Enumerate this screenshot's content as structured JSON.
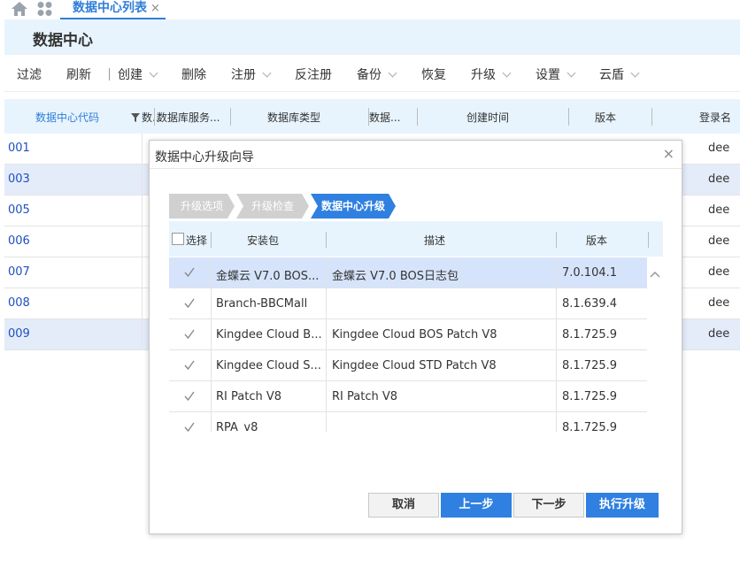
{
  "topbar": {
    "tab_title": "数据中心列表",
    "tab_close": "×"
  },
  "header": {
    "title": "数据中心"
  },
  "toolbar": [
    {
      "label": "过滤",
      "dropdown": false
    },
    {
      "label": "刷新",
      "dropdown": false
    },
    {
      "label": "创建",
      "dropdown": true
    },
    {
      "label": "删除",
      "dropdown": false
    },
    {
      "label": "注册",
      "dropdown": true
    },
    {
      "label": "反注册",
      "dropdown": false
    },
    {
      "label": "备份",
      "dropdown": true
    },
    {
      "label": "恢复",
      "dropdown": false
    },
    {
      "label": "升级",
      "dropdown": true
    },
    {
      "label": "设置",
      "dropdown": true
    },
    {
      "label": "云盾",
      "dropdown": true
    }
  ],
  "grid": {
    "headers": [
      "数据中心代码",
      "数...",
      "数据库服务...",
      "数据库类型",
      "数据...",
      "创建时间",
      "版本",
      "登录名"
    ],
    "rows": [
      {
        "code": "001",
        "login": "dee",
        "selected": false
      },
      {
        "code": "003",
        "login": "dee",
        "selected": true
      },
      {
        "code": "005",
        "login": "dee",
        "selected": false
      },
      {
        "code": "006",
        "login": "dee",
        "selected": false
      },
      {
        "code": "007",
        "login": "dee",
        "selected": false
      },
      {
        "code": "008",
        "login": "dee",
        "selected": false
      },
      {
        "code": "009",
        "login": "dee",
        "selected": true
      }
    ]
  },
  "dialog": {
    "title": "数据中心升级向导",
    "close": "×",
    "steps": [
      {
        "label": "升级选项",
        "active": false
      },
      {
        "label": "升级检查",
        "active": false
      },
      {
        "label": "数据中心升级",
        "active": true
      }
    ],
    "table": {
      "select_all_label": "选择",
      "headers": [
        "安装包",
        "描述",
        "版本"
      ],
      "rows": [
        {
          "package": "金蝶云 V7.0 BOS...",
          "description": "金蝶云 V7.0 BOS日志包",
          "version": "7.0.104.1",
          "checked": true,
          "selected": true
        },
        {
          "package": "Branch-BBCMall",
          "description": "",
          "version": "8.1.639.4",
          "checked": true,
          "selected": false
        },
        {
          "package": "Kingdee Cloud B...",
          "description": "Kingdee Cloud BOS Patch V8",
          "version": "8.1.725.9",
          "checked": true,
          "selected": false
        },
        {
          "package": "Kingdee Cloud S...",
          "description": "Kingdee Cloud STD Patch V8",
          "version": "8.1.725.9",
          "checked": true,
          "selected": false
        },
        {
          "package": "RI Patch V8",
          "description": "RI Patch V8",
          "version": "8.1.725.9",
          "checked": true,
          "selected": false
        },
        {
          "package": "RPA_v8",
          "description": "",
          "version": "8.1.725.9",
          "checked": true,
          "selected": false
        }
      ]
    },
    "buttons": {
      "cancel": "取消",
      "prev": "上一步",
      "next": "下一步",
      "run": "执行升级"
    }
  },
  "colors": {
    "accent": "#2f80e0",
    "header_bg": "#e8f4fd",
    "row_selected": "#e4ecfa",
    "step_active": "#2f80e0",
    "step_inactive": "#d0d0d0"
  }
}
